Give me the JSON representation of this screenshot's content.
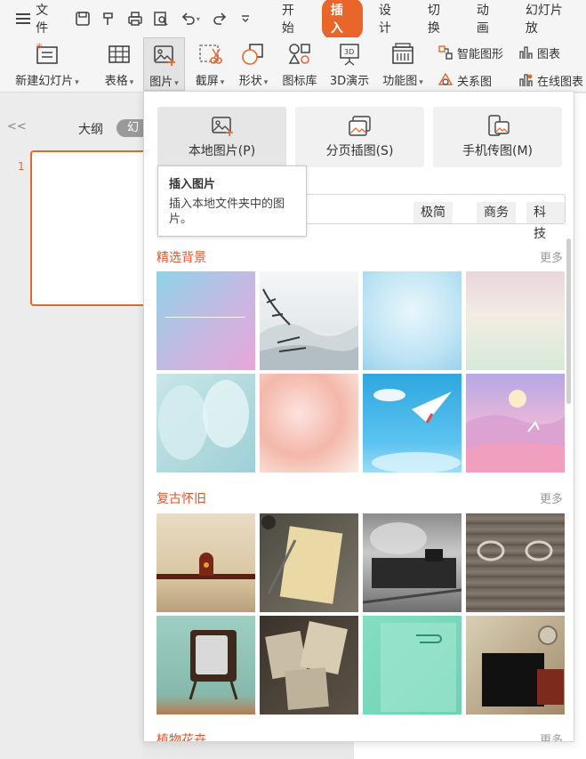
{
  "menubar": {
    "file_label": "文件",
    "tabs": [
      "开始",
      "插入",
      "设计",
      "切换",
      "动画",
      "幻灯片放"
    ],
    "active_tab": "插入",
    "accent": "#e8662a"
  },
  "ribbon": {
    "new_slide": "新建幻灯片",
    "table": "表格",
    "picture": "图片",
    "screenshot": "截屏",
    "shape": "形状",
    "icon_lib": "图标库",
    "threed": "3D演示",
    "func_chart": "功能图",
    "smart_art": "智能图形",
    "chart": "图表",
    "relation": "关系图",
    "online_chart": "在线图表"
  },
  "leftpane": {
    "collapse": "<<",
    "outline": "大纲",
    "slides": "幻",
    "slide_number": "1"
  },
  "dropdown": {
    "options": [
      "本地图片(P)",
      "分页插图(S)",
      "手机传图(M)"
    ],
    "tags": [
      "极简",
      "商务",
      "科技"
    ],
    "sections": [
      {
        "title": "精选背景",
        "more": "更多"
      },
      {
        "title": "复古怀旧",
        "more": "更多"
      },
      {
        "title": "植物花卉",
        "more": "更多"
      }
    ]
  },
  "tooltip": {
    "title": "插入图片",
    "desc": "插入本地文件夹中的图片。"
  }
}
